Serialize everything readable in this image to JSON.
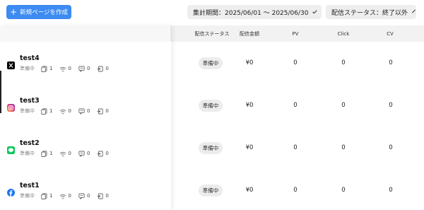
{
  "toolbar": {
    "create_label": "新規ページを作成",
    "period_label": "集計期間：2025/06/01 〜 2025/06/30",
    "status_filter_label": "配信ステータス：終了以外"
  },
  "columns": {
    "status": "配信ステータス",
    "amount": "配信金額",
    "pv": "PV",
    "click": "Click",
    "cv": "CV"
  },
  "rows": [
    {
      "name": "test4",
      "platform": "x-icon",
      "status_small": "準備中",
      "pages": "1",
      "views": "0",
      "stat3": "0",
      "stat4": "0",
      "status": "準備中",
      "amount": "¥0",
      "pv": "0",
      "click": "0",
      "cv": "0"
    },
    {
      "name": "test3",
      "platform": "instagram-icon",
      "status_small": "準備中",
      "pages": "1",
      "views": "0",
      "stat3": "0",
      "stat4": "0",
      "status": "準備中",
      "amount": "¥0",
      "pv": "0",
      "click": "0",
      "cv": "0"
    },
    {
      "name": "test2",
      "platform": "line-icon",
      "status_small": "準備中",
      "pages": "1",
      "views": "0",
      "stat3": "0",
      "stat4": "0",
      "status": "準備中",
      "amount": "¥0",
      "pv": "0",
      "click": "0",
      "cv": "0"
    },
    {
      "name": "test1",
      "platform": "facebook-icon",
      "status_small": "準備中",
      "pages": "1",
      "views": "0",
      "stat3": "0",
      "stat4": "0",
      "status": "準備中",
      "amount": "¥0",
      "pv": "0",
      "click": "0",
      "cv": "0"
    }
  ],
  "colors": {
    "accent": "#3d8bf2",
    "line": "#06c755",
    "facebook": "#1877f2"
  }
}
